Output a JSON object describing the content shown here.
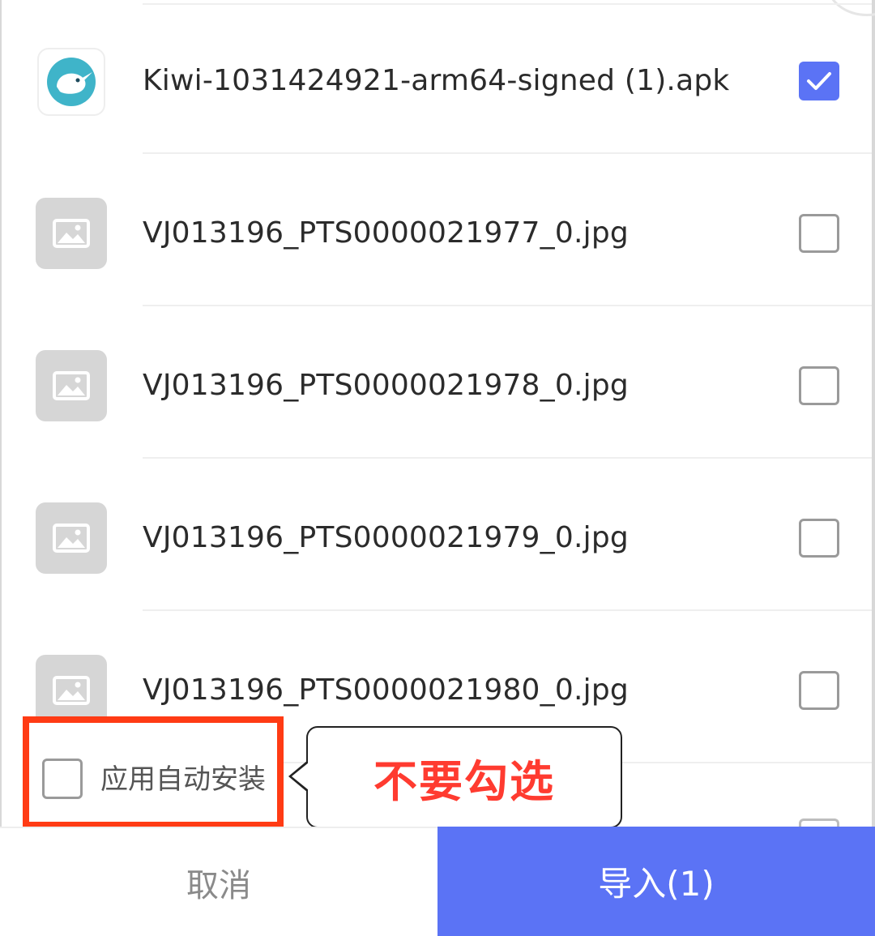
{
  "files": [
    {
      "name": "Kiwi-1031424921-arm64-signed (1).apk",
      "icon": "kiwi-app-icon",
      "checked": true
    },
    {
      "name": "VJ013196_PTS0000021977_0.jpg",
      "icon": "image-icon",
      "checked": false
    },
    {
      "name": "VJ013196_PTS0000021978_0.jpg",
      "icon": "image-icon",
      "checked": false
    },
    {
      "name": "VJ013196_PTS0000021979_0.jpg",
      "icon": "image-icon",
      "checked": false
    },
    {
      "name": "VJ013196_PTS0000021980_0.jpg",
      "icon": "image-icon",
      "checked": false
    }
  ],
  "auto_install": {
    "label": "应用自动安装",
    "checked": false
  },
  "callout": {
    "text": "不要勾选"
  },
  "footer": {
    "cancel_label": "取消",
    "import_label": "导入(1)"
  },
  "colors": {
    "accent": "#5b73f5",
    "annotation_red": "#ff3b14",
    "callout_text": "#ff3b30"
  }
}
